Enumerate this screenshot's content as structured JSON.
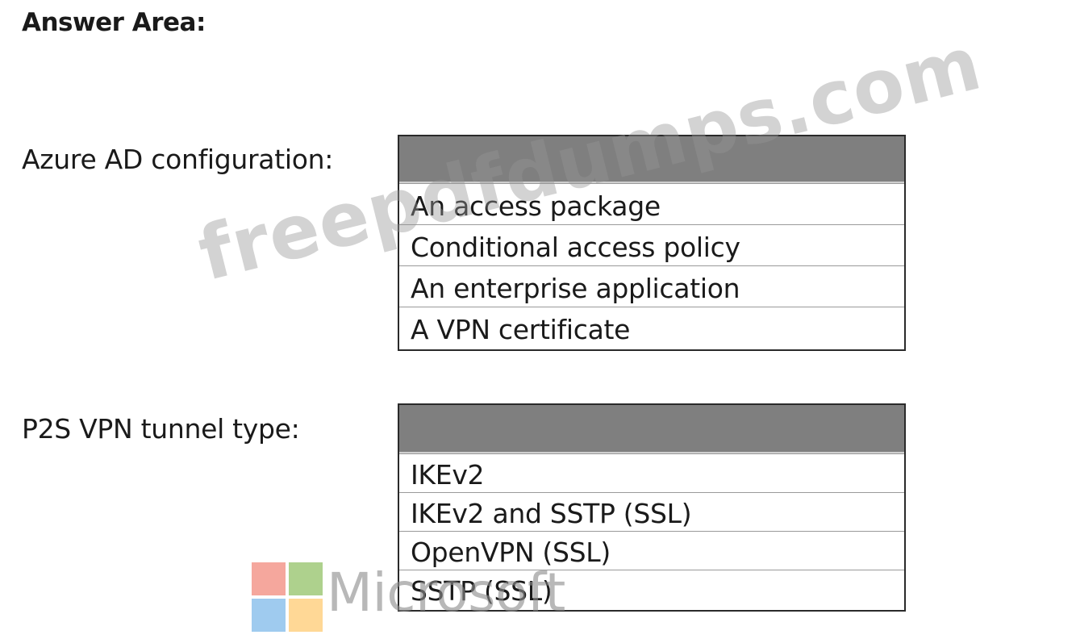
{
  "answer_area": {
    "title": "Answer Area:"
  },
  "questions": [
    {
      "label": "Azure AD configuration:",
      "selected": "",
      "options": [
        "An access package",
        "Conditional access policy",
        "An enterprise application",
        "A VPN certificate"
      ]
    },
    {
      "label": "P2S VPN tunnel type:",
      "selected": "",
      "options": [
        "IKEv2",
        "IKEv2 and SSTP (SSL)",
        "OpenVPN (SSL)",
        "SSTP (SSL)"
      ]
    }
  ],
  "watermark": {
    "text": "freepdfdumps.com"
  },
  "logo": {
    "text": "Microsoft",
    "icon": "microsoft-logo-icon"
  }
}
